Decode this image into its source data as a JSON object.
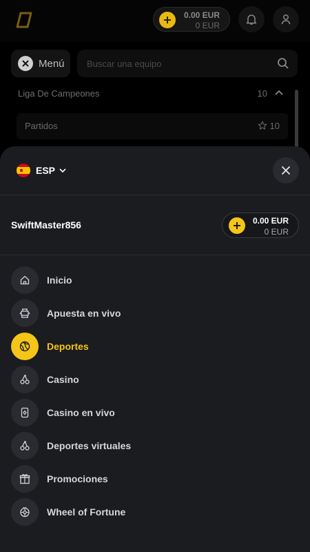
{
  "header": {
    "balance_main": "0.00 EUR",
    "balance_sub": "0 EUR"
  },
  "background": {
    "menu_label": "Menú",
    "search_placeholder": "Buscar una equipo",
    "league": {
      "name": "Liga De Campeones",
      "count": "10"
    },
    "sub": {
      "name": "Partidos",
      "count": "10"
    }
  },
  "drawer": {
    "language": "ESP",
    "username": "SwiftMaster856",
    "balance_main": "0.00 EUR",
    "balance_sub": "0 EUR",
    "nav": [
      {
        "label": "Inicio",
        "icon": "home-icon",
        "active": false
      },
      {
        "label": "Apuesta en vivo",
        "icon": "live-bet-icon",
        "active": false
      },
      {
        "label": "Deportes",
        "icon": "basketball-icon",
        "active": true
      },
      {
        "label": "Casino",
        "icon": "cherries-icon",
        "active": false
      },
      {
        "label": "Casino en vivo",
        "icon": "card-icon",
        "active": false
      },
      {
        "label": "Deportes virtuales",
        "icon": "cherries-icon",
        "active": false
      },
      {
        "label": "Promociones",
        "icon": "gift-icon",
        "active": false
      },
      {
        "label": "Wheel of Fortune",
        "icon": "wheel-icon",
        "active": false
      }
    ]
  },
  "colors": {
    "accent": "#f5c518",
    "sheet_bg": "#1b1c20",
    "icon_bg": "#2a2b30"
  }
}
